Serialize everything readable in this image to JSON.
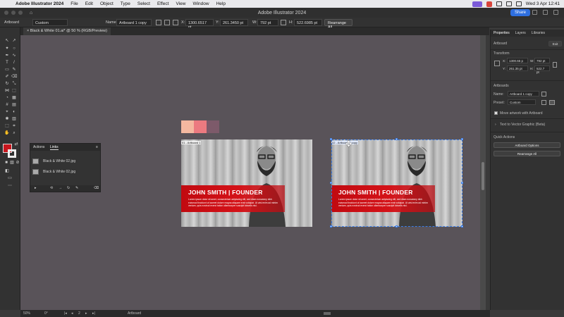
{
  "menubar": {
    "app_name": "Adobe Illustrator 2024",
    "menus": [
      "File",
      "Edit",
      "Object",
      "Type",
      "Select",
      "Effect",
      "View",
      "Window",
      "Help"
    ],
    "clock": "Wed 3 Apr  12:41"
  },
  "titlebar": {
    "title": "Adobe Illustrator 2024",
    "share_label": "Share"
  },
  "controlbar": {
    "context": "Artboard",
    "preset": "Custom",
    "name_label": "Name:",
    "name_value": "Artboard 1 copy",
    "x_label": "X:",
    "x_value": "1300.6517 pt",
    "y_label": "Y:",
    "y_value": "261.3450 pt",
    "w_label": "W:",
    "w_value": "792 pt",
    "h_label": "H:",
    "h_value": "522.6985 pt",
    "rearrange_label": "Rearrange All"
  },
  "document": {
    "tab_title": "Black & White 01.ai* @ 50 % (RGB/Preview)",
    "tab_close": "×"
  },
  "artboards": [
    {
      "label": "01 - Artboard 1",
      "headline": "JOHN SMITH | FOUNDER",
      "body": "Lorem ipsum dolor sit amet, consectetuer adipiscing elit, sed diam nonummy nibh euismod tincidunt ut laoreet dolore magna aliquam erat volutpat. Ut wisi enim ad minim veniam, quis nostrud exerci tation ullamcorper suscipit lobortis nisl."
    },
    {
      "label": "02 - Artboard 1 copy",
      "headline": "JOHN SMITH | FOUNDER",
      "body": "Lorem ipsum dolor sit amet, consectetuer adipiscing elit, sed diam nonummy nibh euismod tincidunt ut laoreet dolore magna aliquam erat volutpat. Ut wisi enim ad minim veniam, quis nostrud exerci tation ullamcorper suscipit lobortis nisl."
    }
  ],
  "swatches": [
    "#f4b8a0",
    "#ec7a80",
    "#7d5a6a"
  ],
  "links_panel": {
    "tabs": [
      "Actions",
      "Links"
    ],
    "active_tab": "Links",
    "items": [
      "Black & White 02.jpg",
      "Black & White 02.jpg"
    ]
  },
  "properties": {
    "tabs": [
      "Properties",
      "Layers",
      "Libraries"
    ],
    "active_tab": "Properties",
    "selection_type": "Artboard",
    "exit_label": "Exit",
    "transform_heading": "Transform",
    "x_value": "1300.65 p",
    "y_value": "261.35 pt",
    "w_value": "792 pt",
    "h_value": "522.7 pt",
    "artboards_heading": "Artboards",
    "name_label": "Name:",
    "name_value": "Artboard 1 copy",
    "preset_label": "Preset:",
    "preset_value": "Custom",
    "move_artwork_label": "Move artwork with Artboard",
    "text_to_vector_label": "Text to Vector Graphic (Beta)",
    "quick_actions_heading": "Quick Actions",
    "artboard_options_label": "Artboard Options",
    "rearrange_all_label": "Rearrange All"
  },
  "statusbar": {
    "zoom": "50%",
    "rotation": "0°",
    "artboard_number": "2",
    "mode": "Artboard"
  },
  "colors": {
    "fill": "#c8161d",
    "canvas": "#595359",
    "selection": "#3d7fe8",
    "banner_red": "#d41218"
  }
}
